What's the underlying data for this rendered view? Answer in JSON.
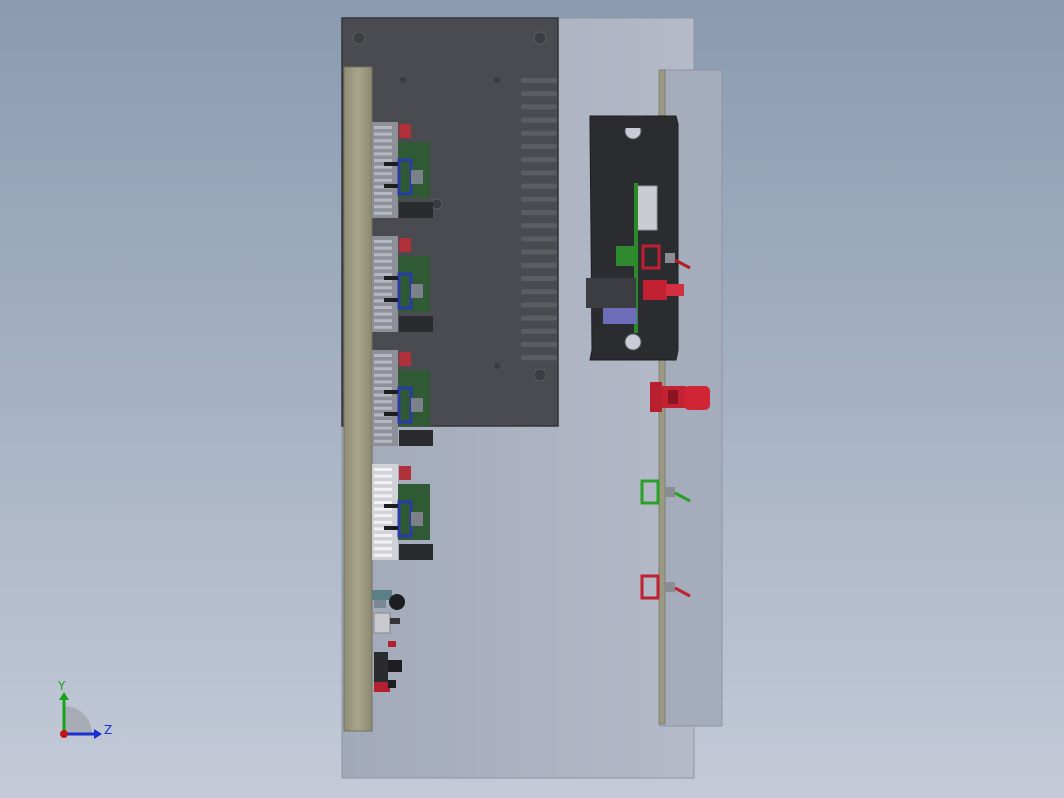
{
  "viewport": {
    "background_top": "#8a9bb0",
    "background_bottom": "#c4cad8"
  },
  "model": {
    "enclosure_color": "#a9b0bf",
    "heatsink_color": "#4a4b50",
    "rail_color": "#9c9a82",
    "pcb_color": "#2f5a34",
    "connector_color": "#b0303a",
    "bracket_color": "#2b2c30",
    "driver_module_count": 4,
    "toggle_switch_count": 3
  },
  "triad": {
    "y_label": "Y",
    "z_label": "Z",
    "y_color": "#1aa31a",
    "z_color": "#1a2fd0",
    "x_color": "#c01818"
  }
}
